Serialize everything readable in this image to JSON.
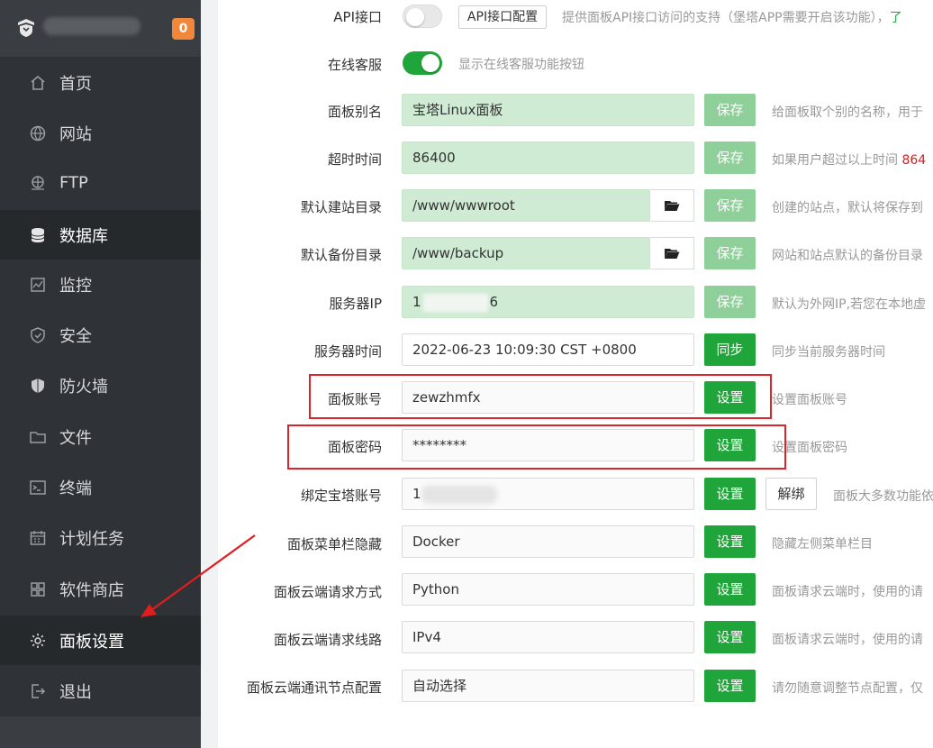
{
  "sidebar": {
    "badge": "0",
    "items": [
      {
        "label": "首页",
        "icon": "home-icon",
        "active": false
      },
      {
        "label": "网站",
        "icon": "globe-icon",
        "active": false
      },
      {
        "label": "FTP",
        "icon": "ftp-icon",
        "active": false
      },
      {
        "label": "数据库",
        "icon": "database-icon",
        "active": true
      },
      {
        "label": "监控",
        "icon": "monitor-icon",
        "active": false
      },
      {
        "label": "安全",
        "icon": "shield-icon",
        "active": false
      },
      {
        "label": "防火墙",
        "icon": "firewall-icon",
        "active": false
      },
      {
        "label": "文件",
        "icon": "folder-icon",
        "active": false
      },
      {
        "label": "终端",
        "icon": "terminal-icon",
        "active": false
      },
      {
        "label": "计划任务",
        "icon": "calendar-icon",
        "active": false
      },
      {
        "label": "软件商店",
        "icon": "grid-icon",
        "active": false
      },
      {
        "label": "面板设置",
        "icon": "gear-icon",
        "active": false
      },
      {
        "label": "退出",
        "icon": "logout-icon",
        "active": false
      }
    ]
  },
  "settings": {
    "api": {
      "label": "API接口",
      "button": "API接口配置",
      "hint": "提供面板API接口访问的支持（堡塔APP需要开启该功能），",
      "hint_link": "了"
    },
    "online_service": {
      "label": "在线客服",
      "hint": "显示在线客服功能按钮"
    },
    "alias": {
      "label": "面板别名",
      "value": "宝塔Linux面板",
      "button": "保存",
      "hint": "给面板取个别的名称，用于"
    },
    "timeout": {
      "label": "超时时间",
      "value": "86400",
      "button": "保存",
      "hint": "如果用户超过以上时间 ",
      "hint_red": "864"
    },
    "site_dir": {
      "label": "默认建站目录",
      "value": "/www/wwwroot",
      "button": "保存",
      "hint": "创建的站点，默认将保存到"
    },
    "backup_dir": {
      "label": "默认备份目录",
      "value": "/www/backup",
      "button": "保存",
      "hint": "网站和站点默认的备份目录"
    },
    "server_ip": {
      "label": "服务器IP",
      "value_start": "1",
      "value_end": "6",
      "button": "保存",
      "hint": "默认为外网IP,若您在本地虚"
    },
    "server_time": {
      "label": "服务器时间",
      "value": "2022-06-23 10:09:30 CST +0800",
      "button": "同步",
      "hint": "同步当前服务器时间"
    },
    "panel_account": {
      "label": "面板账号",
      "value": "zewzhmfx",
      "button": "设置",
      "hint": "设置面板账号"
    },
    "panel_password": {
      "label": "面板密码",
      "value": "********",
      "button": "设置",
      "hint": "设置面板密码"
    },
    "bind_account": {
      "label": "绑定宝塔账号",
      "value_start": "1",
      "button": "设置",
      "button2": "解绑",
      "hint": "面板大多数功能依"
    },
    "menu_hide": {
      "label": "面板菜单栏隐藏",
      "value": "Docker",
      "button": "设置",
      "hint": "隐藏左侧菜单栏目"
    },
    "cloud_method": {
      "label": "面板云端请求方式",
      "value": "Python",
      "button": "设置",
      "hint": "面板请求云端时，使用的请"
    },
    "cloud_route": {
      "label": "面板云端请求线路",
      "value": "IPv4",
      "button": "设置",
      "hint": "面板请求云端时，使用的请"
    },
    "cloud_node": {
      "label": "面板云端通讯节点配置",
      "value": "自动选择",
      "button": "设置",
      "hint": "请勿随意调整节点配置，仅"
    }
  },
  "colors": {
    "sidebar_bg": "#2f3236",
    "accent_green": "#20a53a",
    "highlight_red": "#d9252b",
    "badge_orange": "#f0873a"
  }
}
